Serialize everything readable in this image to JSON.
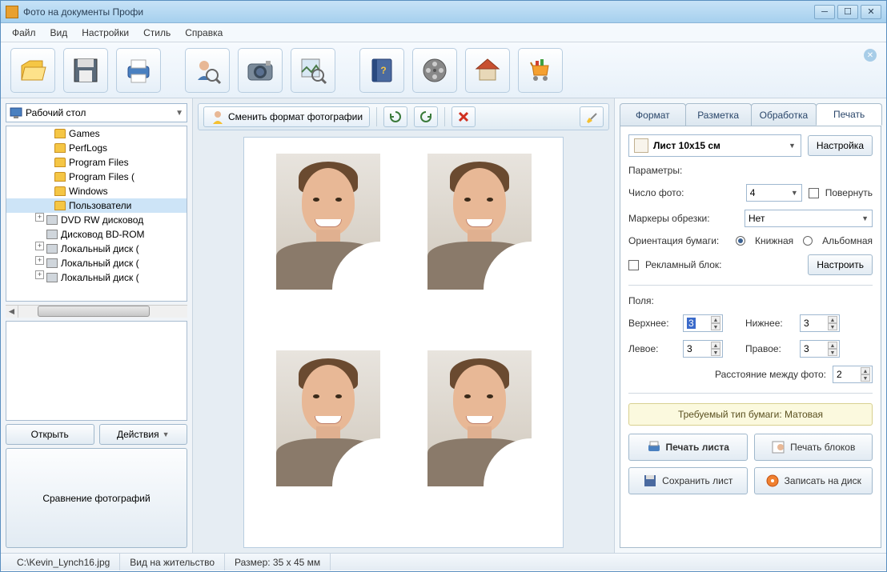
{
  "window": {
    "title": "Фото на документы Профи"
  },
  "menu": {
    "file": "Файл",
    "view": "Вид",
    "settings": "Настройки",
    "style": "Стиль",
    "help": "Справка"
  },
  "left": {
    "location": "Рабочий стол",
    "tree": {
      "games": "Games",
      "perflogs": "PerfLogs",
      "progfiles": "Program Files",
      "progfiles2": "Program Files (",
      "windows": "Windows",
      "users": "Пользователи",
      "dvdrw": "DVD RW дисковод",
      "bdrom": "Дисковод BD-ROM",
      "disk1": "Локальный диск (",
      "disk2": "Локальный диск (",
      "disk3": "Локальный диск ("
    },
    "open_btn": "Открыть",
    "actions_btn": "Действия",
    "compare_btn": "Сравнение фотографий"
  },
  "center": {
    "change_format": "Сменить формат фотографии"
  },
  "right": {
    "tabs": {
      "format": "Формат",
      "markup": "Разметка",
      "processing": "Обработка",
      "print": "Печать"
    },
    "sheet": "Лист 10x15 см",
    "setup_btn": "Настройка",
    "params_label": "Параметры:",
    "photo_count_label": "Число фото:",
    "photo_count": "4",
    "rotate_label": "Повернуть",
    "crop_label": "Маркеры обрезки:",
    "crop_value": "Нет",
    "orient_label": "Ориентация бумаги:",
    "orient_book": "Книжная",
    "orient_album": "Альбомная",
    "adblock_label": "Рекламный блок:",
    "adblock_btn": "Настроить",
    "margins_label": "Поля:",
    "top_label": "Верхнее:",
    "top_val": "3",
    "bottom_label": "Нижнее:",
    "bottom_val": "3",
    "left_label": "Левое:",
    "left_val": "3",
    "right_label": "Правое:",
    "right_val": "3",
    "gap_label": "Расстояние между фото:",
    "gap_val": "2",
    "paper_note": "Требуемый тип бумаги: Матовая",
    "print_sheet": "Печать листа",
    "print_blocks": "Печать блоков",
    "save_sheet": "Сохранить лист",
    "burn_disc": "Записать на диск"
  },
  "status": {
    "file": "C:\\Kevin_Lynch16.jpg",
    "doctype": "Вид на жительство",
    "size": "Размер: 35 x 45 мм"
  }
}
